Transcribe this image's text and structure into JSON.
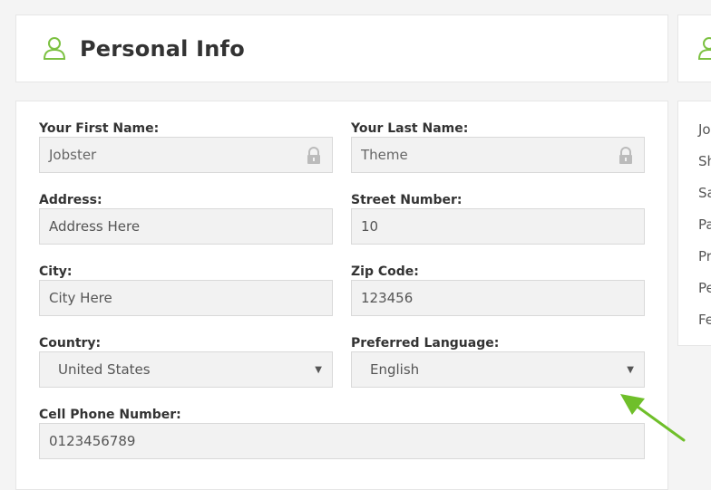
{
  "header": {
    "title": "Personal Info",
    "icon": "user-icon",
    "accent_color": "#7cc142"
  },
  "form": {
    "first_name": {
      "label": "Your First Name:",
      "value": "Jobster",
      "locked": true
    },
    "last_name": {
      "label": "Your Last Name:",
      "value": "Theme",
      "locked": true
    },
    "address": {
      "label": "Address:",
      "placeholder": "Address Here"
    },
    "street_number": {
      "label": "Street Number:",
      "value": "10"
    },
    "city": {
      "label": "City:",
      "placeholder": "City Here"
    },
    "zip_code": {
      "label": "Zip Code:",
      "value": "123456"
    },
    "country": {
      "label": "Country:",
      "selected": "United States"
    },
    "preferred_language": {
      "label": "Preferred Language:",
      "selected": "English"
    },
    "cell_phone": {
      "label": "Cell Phone Number:",
      "value": "0123456789"
    }
  },
  "right_panel": {
    "icon": "user-icon",
    "items": [
      "Jo",
      "Sh",
      "Sa",
      "Pa",
      "Pr",
      "Pe",
      "Fe"
    ]
  },
  "annotation": {
    "arrow_color": "#6fbf2a"
  }
}
